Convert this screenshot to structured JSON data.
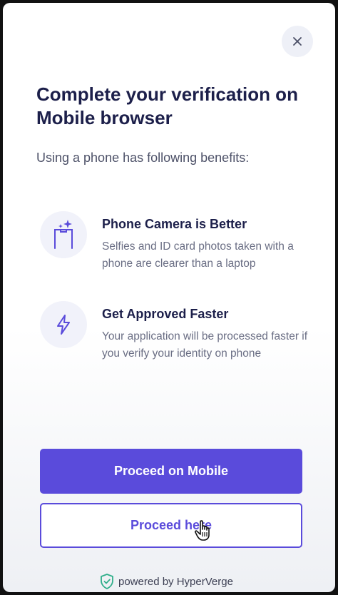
{
  "modal": {
    "close_icon": "close-icon",
    "title": "Complete your verification on Mobile browser",
    "subtitle": "Using a phone has following benefits:",
    "benefits": [
      {
        "icon": "phone-camera-icon",
        "title": "Phone Camera is Better",
        "description": "Selfies and ID card photos taken with a phone are clearer than a laptop"
      },
      {
        "icon": "lightning-icon",
        "title": "Get Approved Faster",
        "description": "Your application will be processed faster if you verify your identity on phone"
      }
    ],
    "primary_button": "Proceed on Mobile",
    "secondary_button": "Proceed here",
    "footer": {
      "icon": "shield-check-icon",
      "text": "powered by HyperVerge"
    }
  },
  "colors": {
    "accent": "#5a4bdb",
    "title": "#1c1f4a",
    "footer_icon": "#2fae8a"
  }
}
